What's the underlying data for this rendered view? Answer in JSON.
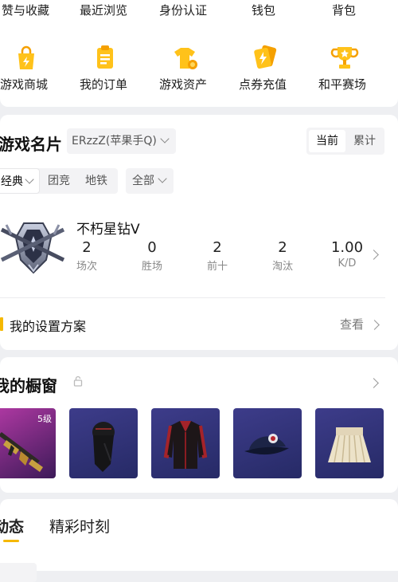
{
  "top_row": [
    "赞与收藏",
    "最近浏览",
    "身份认证",
    "钱包",
    "背包"
  ],
  "services": [
    {
      "label": "游戏商城",
      "icon": "shopping-bag-icon"
    },
    {
      "label": "我的订单",
      "icon": "clipboard-icon"
    },
    {
      "label": "游戏资产",
      "icon": "tshirt-coin-icon"
    },
    {
      "label": "点券充值",
      "icon": "lightning-card-icon"
    },
    {
      "label": "和平赛场",
      "icon": "trophy-icon"
    }
  ],
  "game_card": {
    "title": "游戏名片",
    "account": "ERzzZ(苹果手Q)",
    "toggle": [
      "当前",
      "累计"
    ],
    "modes": [
      "经典",
      "团竞",
      "地铁"
    ],
    "filter": "全部",
    "rank": "不朽星钻Ⅴ",
    "stats": [
      {
        "value": "2",
        "label": "场次"
      },
      {
        "value": "0",
        "label": "胜场"
      },
      {
        "value": "2",
        "label": "前十"
      },
      {
        "value": "2",
        "label": "淘汰"
      },
      {
        "value": "1.00",
        "label": "K/D"
      }
    ],
    "settings_label": "我的设置方案",
    "settings_link": "查看"
  },
  "showcase": {
    "title": "我的橱窗",
    "level_badge": "5级",
    "items": [
      "assault-rifle",
      "black-scarf-mask",
      "red-black-jacket",
      "navy-cap",
      "khaki-skirt"
    ]
  },
  "feed_tabs": [
    "动态",
    "精彩时刻"
  ],
  "colors": {
    "accent": "#f5b800",
    "background": "#eeeff2",
    "card": "#ffffff"
  }
}
